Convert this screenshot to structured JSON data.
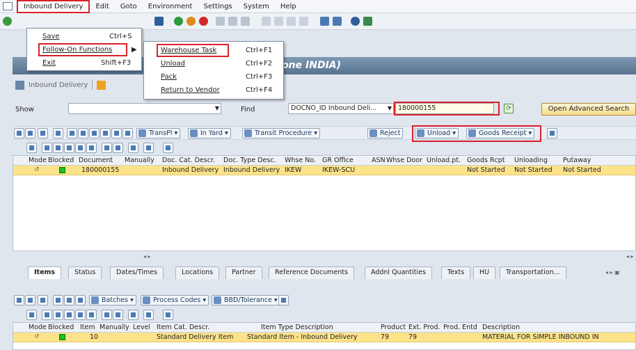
{
  "menu": {
    "items": [
      "Inbound Delivery",
      "Edit",
      "Goto",
      "Environment",
      "Settings",
      "System",
      "Help"
    ]
  },
  "inbound_menu": {
    "items": [
      {
        "label": "Save",
        "shortcut": "Ctrl+S"
      },
      {
        "label": "Follow-On Functions",
        "shortcut": "▶"
      },
      {
        "label": "Exit",
        "shortcut": "Shift+F3"
      }
    ]
  },
  "followon_menu": {
    "items": [
      {
        "label": "Warehouse Task",
        "shortcut": "Ctrl+F1"
      },
      {
        "label": "Unload",
        "shortcut": "Ctrl+F2"
      },
      {
        "label": "Pack",
        "shortcut": "Ctrl+F3"
      },
      {
        "label": "Return to Vendor",
        "shortcut": "Ctrl+F4"
      }
    ]
  },
  "title": "er IKEW (Time Zone INDIA)",
  "appbar": {
    "inbound_delivery": "Inbound Delivery"
  },
  "filter": {
    "show_label": "Show",
    "find_label": "Find",
    "find_field": "DOCNO_ID Inbound Deli...",
    "find_value": "180000155",
    "advanced_search": "Open Advanced Search"
  },
  "top_toolbar": {
    "transpl": "TransPl",
    "in_yard": "In Yard",
    "transit_procedure": "Transit Procedure",
    "reject": "Reject",
    "unload": "Unload",
    "goods_receipt": "Goods Receipt"
  },
  "top_grid": {
    "headers": [
      "Mode",
      "Blocked",
      "Document",
      "Manually",
      "Doc. Cat. Descr.",
      "Doc. Type Desc.",
      "Whse No.",
      "GR Office",
      "ASN",
      "Whse Door",
      "Unload.pt.",
      "Goods Rcpt",
      "Unloading",
      "Putaway"
    ],
    "row": {
      "document": "180000155",
      "doc_cat": "Inbound Delivery",
      "doc_type": "Inbound Delivery",
      "whse_no": "IKEW",
      "gr_office": "IKEW-SCU",
      "goods_rcpt": "Not Started",
      "unloading": "Not Started",
      "putaway": "Not Started"
    }
  },
  "tabs": [
    "Items",
    "Status",
    "Dates/Times",
    "Locations",
    "Partner",
    "Reference Documents",
    "Addnl Quantities",
    "Texts",
    "HU",
    "Transportation..."
  ],
  "item_toolbar": {
    "batches": "Batches",
    "process_codes": "Process Codes",
    "bbd_tolerance": "BBD/Tolerance"
  },
  "item_grid": {
    "headers": [
      "Mode",
      "Blocked",
      "Item",
      "Manually",
      "Level",
      "Item Cat. Descr.",
      "Item Type Description",
      "Product",
      "Ext. Prod.",
      "Prod. Entd",
      "Description"
    ],
    "row": {
      "item": "10",
      "item_cat": "Standard Delivery Item",
      "item_type": "Standard Item - Inbound Delivery",
      "product": "79",
      "ext_prod": "79",
      "description": "MATERIAL FOR SIMPLE INBOUND IN"
    }
  }
}
